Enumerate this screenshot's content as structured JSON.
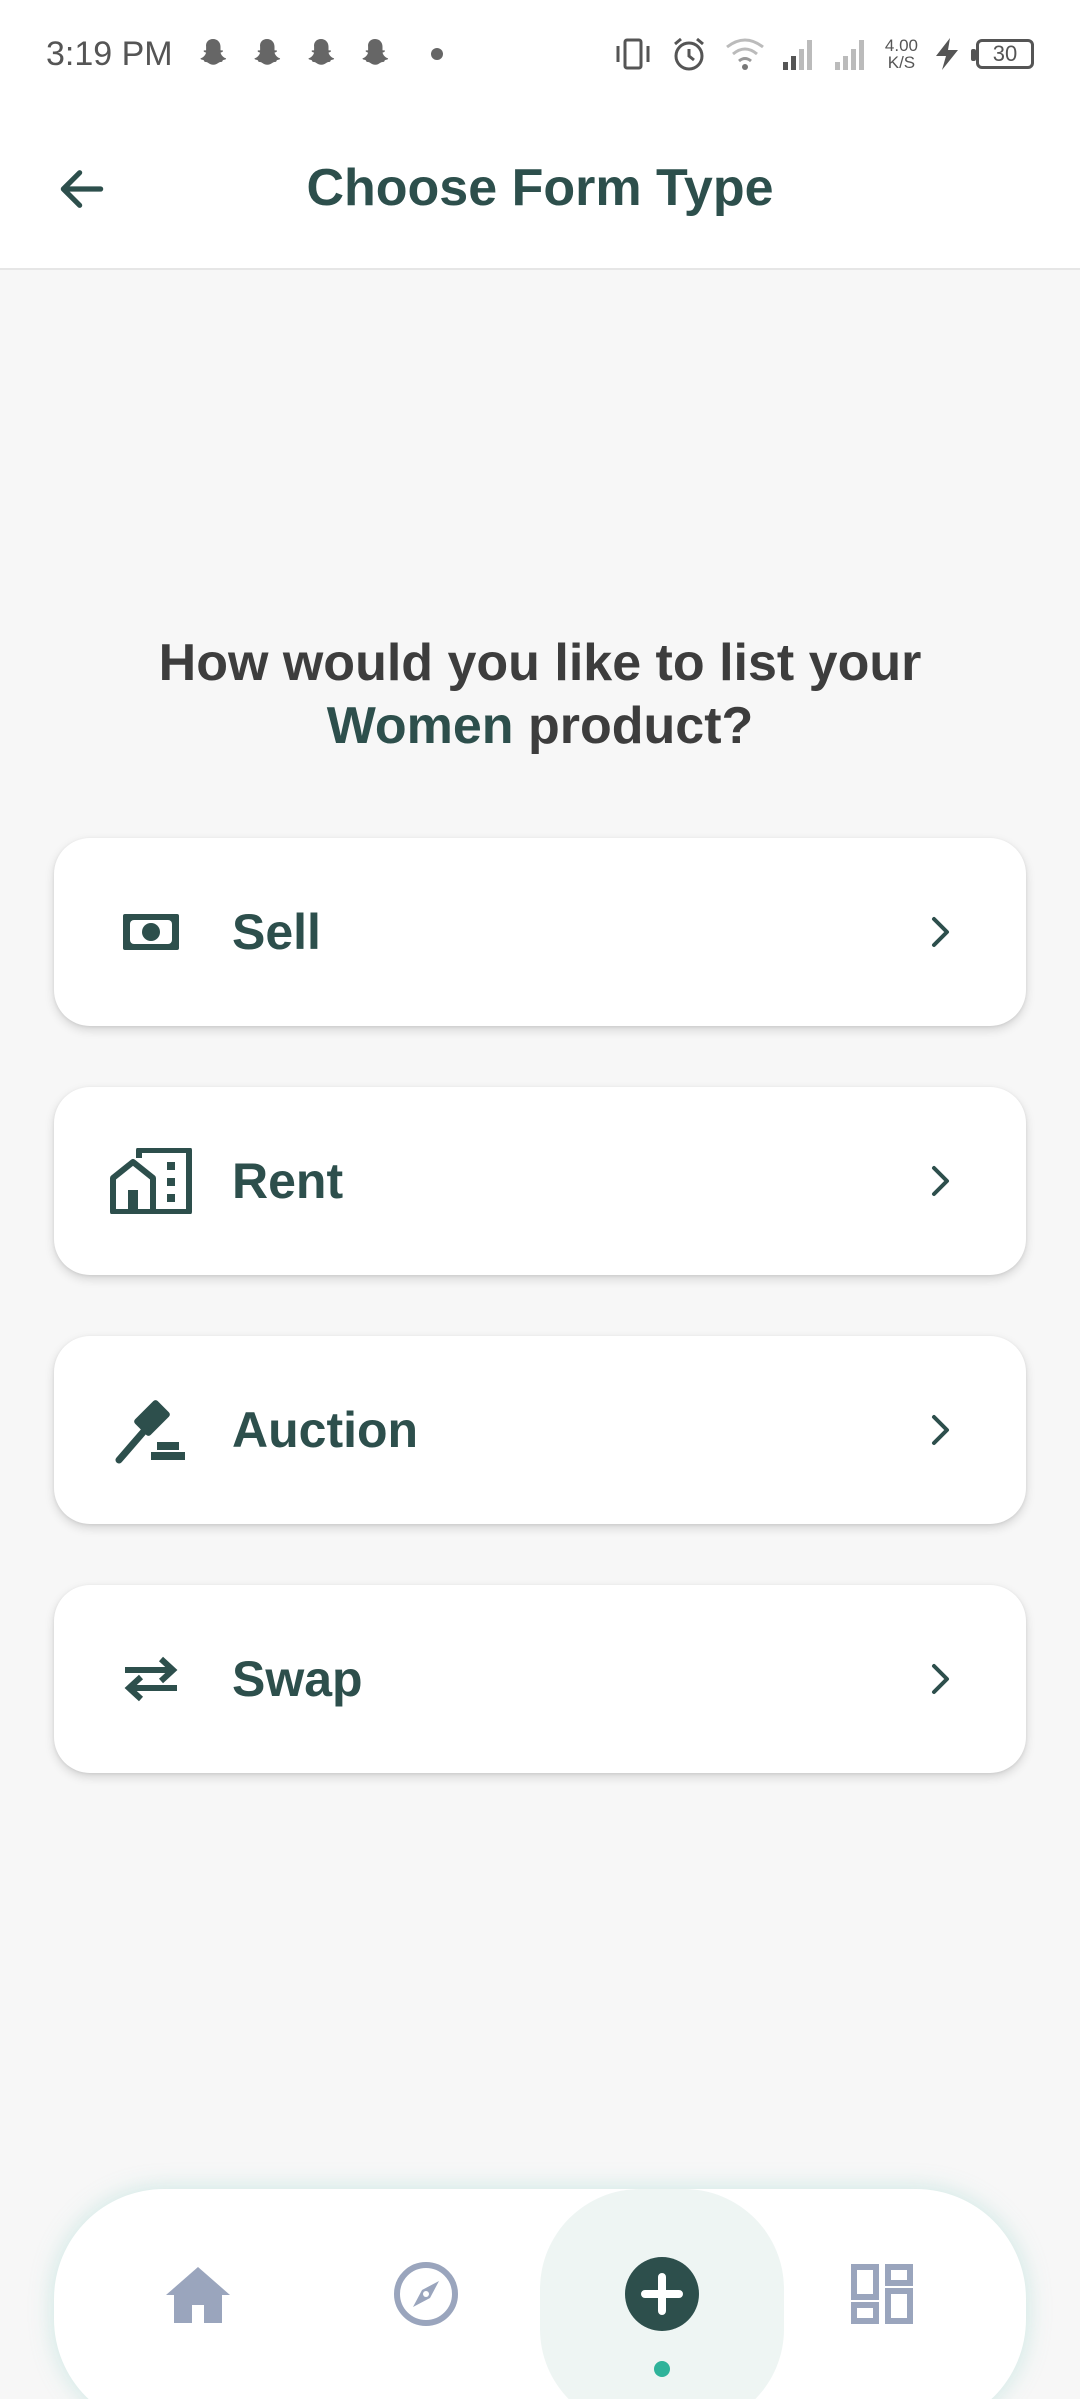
{
  "status_bar": {
    "time": "3:19 PM",
    "net_speed_value": "4.00",
    "net_speed_unit": "K/S",
    "battery_level": "30",
    "notification_icons": [
      "snapchat-icon",
      "snapchat-icon",
      "snapchat-icon",
      "snapchat-icon"
    ]
  },
  "header": {
    "title": "Choose Form Type",
    "back_icon": "arrow-left-icon"
  },
  "question": {
    "line1": "How would you like to list your",
    "category": "Women",
    "line2_suffix": " product?"
  },
  "options": [
    {
      "label": "Sell",
      "icon": "cash-icon"
    },
    {
      "label": "Rent",
      "icon": "building-icon"
    },
    {
      "label": "Auction",
      "icon": "gavel-icon"
    },
    {
      "label": "Swap",
      "icon": "swap-arrows-icon"
    }
  ],
  "bottom_nav": {
    "items": [
      {
        "name": "home",
        "icon": "home-icon",
        "active": false
      },
      {
        "name": "explore",
        "icon": "compass-icon",
        "active": false
      },
      {
        "name": "add",
        "icon": "plus-circle-icon",
        "active": true
      },
      {
        "name": "dashboard",
        "icon": "dashboard-icon",
        "active": false
      }
    ]
  },
  "colors": {
    "primary": "#2d4f4c",
    "accent": "#2fb39a",
    "nav_inactive": "#9aa5bd",
    "background": "#f7f7f7"
  }
}
